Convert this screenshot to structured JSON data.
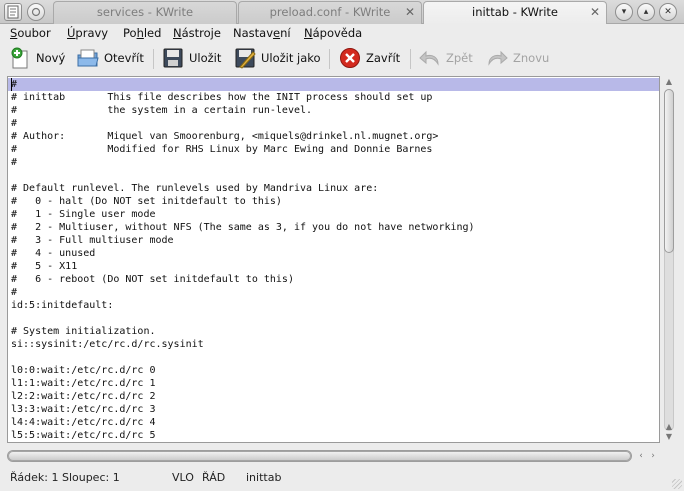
{
  "window": {
    "app_menu_icon": "kwrite-doc-icon",
    "tabs": [
      {
        "label": "services - KWrite",
        "active": false
      },
      {
        "label": "preload.conf - KWrite",
        "active": false
      },
      {
        "label": "inittab - KWrite",
        "active": true
      }
    ],
    "controls": [
      "minimize",
      "maximize",
      "close"
    ]
  },
  "menu": {
    "items": [
      {
        "accel": "S",
        "rest": "oubor"
      },
      {
        "accel": "Ú",
        "rest": "pravy"
      },
      {
        "pre": "Po",
        "accel": "h",
        "rest": "led"
      },
      {
        "accel": "N",
        "rest": "ástroje"
      },
      {
        "pre": "Nastav",
        "accel": "e",
        "rest": "ní"
      },
      {
        "accel": "N",
        "rest": "ápověda"
      }
    ]
  },
  "toolbar": {
    "new_label": "Nový",
    "open_label": "Otevřít",
    "save_label": "Uložit",
    "saveas_label": "Uložit jako",
    "close_label": "Zavřít",
    "undo_label": "Zpět",
    "redo_label": "Znovu"
  },
  "editor": {
    "lines": [
      "#",
      "# inittab       This file describes how the INIT process should set up",
      "#               the system in a certain run-level.",
      "#",
      "# Author:       Miquel van Smoorenburg, <miquels@drinkel.nl.mugnet.org>",
      "#               Modified for RHS Linux by Marc Ewing and Donnie Barnes",
      "#",
      "",
      "# Default runlevel. The runlevels used by Mandriva Linux are:",
      "#   0 - halt (Do NOT set initdefault to this)",
      "#   1 - Single user mode",
      "#   2 - Multiuser, without NFS (The same as 3, if you do not have networking)",
      "#   3 - Full multiuser mode",
      "#   4 - unused",
      "#   5 - X11",
      "#   6 - reboot (Do NOT set initdefault to this)",
      "#",
      "id:5:initdefault:",
      "",
      "# System initialization.",
      "si::sysinit:/etc/rc.d/rc.sysinit",
      "",
      "l0:0:wait:/etc/rc.d/rc 0",
      "l1:1:wait:/etc/rc.d/rc 1",
      "l2:2:wait:/etc/rc.d/rc 2",
      "l3:3:wait:/etc/rc.d/rc 3",
      "l4:4:wait:/etc/rc.d/rc 4",
      "l5:5:wait:/etc/rc.d/rc 5"
    ]
  },
  "status": {
    "position": "Řádek: 1 Sloupec: 1",
    "insert_mode": "VLO",
    "selection_mode": "ŘÁD",
    "filename": "inittab"
  },
  "colors": {
    "current_line": "#b8b9e8",
    "close_icon_red": "#d32a1f",
    "new_icon_green": "#3aa53a"
  }
}
